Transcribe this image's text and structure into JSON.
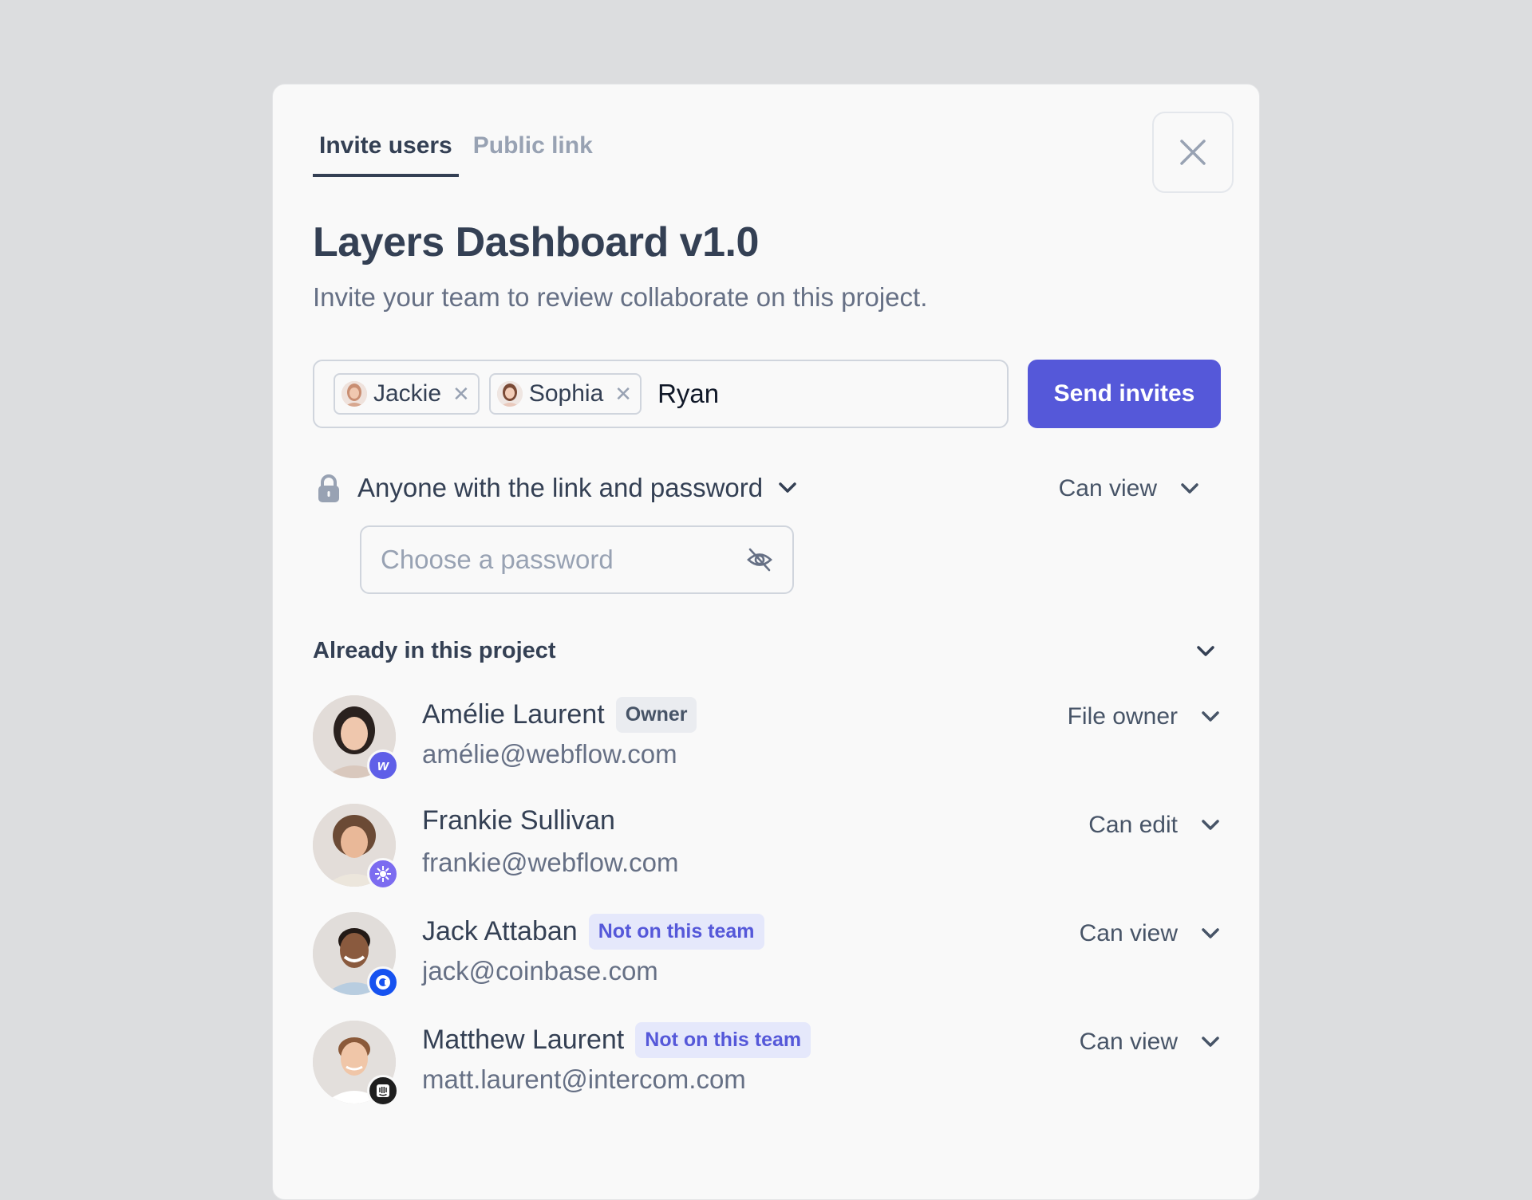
{
  "tabs": [
    {
      "label": "Invite users",
      "active": true
    },
    {
      "label": "Public link",
      "active": false
    }
  ],
  "title": "Layers Dashboard v1.0",
  "subtitle": "Invite your team to review collaborate on this project.",
  "invite": {
    "chips": [
      {
        "name": "Jackie"
      },
      {
        "name": "Sophia"
      }
    ],
    "typed_value": "Ryan",
    "send_label": "Send invites"
  },
  "link_access": {
    "label": "Anyone with the link and password",
    "permission": "Can view",
    "password_placeholder": "Choose a password"
  },
  "members_section": {
    "title": "Already in this project",
    "members": [
      {
        "name": "Amélie Laurent",
        "tag": "Owner",
        "email": "amélie@webflow.com",
        "permission": "File owner"
      },
      {
        "name": "Frankie Sullivan",
        "tag": "",
        "email": "frankie@webflow.com",
        "permission": "Can edit"
      },
      {
        "name": "Jack Attaban",
        "tag": "Not on this team",
        "email": "jack@coinbase.com",
        "permission": "Can view"
      },
      {
        "name": "Matthew Laurent",
        "tag": "Not on this team",
        "email": "matt.laurent@intercom.com",
        "permission": "Can view"
      }
    ]
  },
  "colors": {
    "primary": "#5558d9",
    "background": "#dcdddf",
    "card": "#f9f9f9",
    "text": "#344054",
    "muted": "#667085"
  },
  "icons": [
    "close-icon",
    "lock-icon",
    "chevron-down-icon",
    "eye-off-icon",
    "webflow-logo-icon",
    "sunburst-logo-icon",
    "coinbase-logo-icon",
    "intercom-logo-icon"
  ]
}
